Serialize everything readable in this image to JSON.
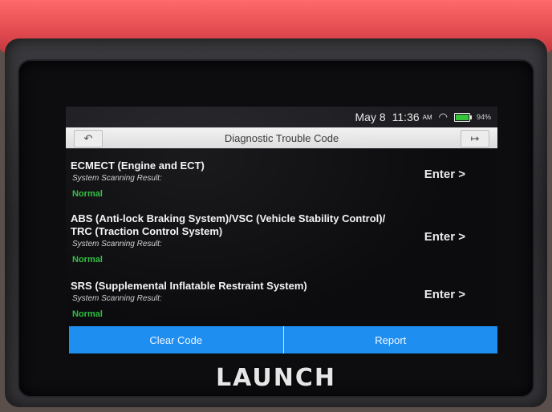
{
  "status_bar": {
    "date": "May 8",
    "time": "11:36",
    "ampm": "AM",
    "battery": "94%",
    "wifi_icon": "wifi-icon",
    "battery_icon": "battery-icon"
  },
  "header": {
    "title": "Diagnostic Trouble Code",
    "back_icon": "back-arrow-icon",
    "exit_icon": "exit-icon"
  },
  "systems": [
    {
      "name": "ECMECT (Engine and ECT)",
      "result_label": "System Scanning Result:",
      "result": "Normal",
      "enter_label": "Enter >"
    },
    {
      "name": "ABS (Anti-lock Braking System)/VSC (Vehicle Stability Control)/ TRC (Traction Control System)",
      "result_label": "System Scanning Result:",
      "result": "Normal",
      "enter_label": "Enter >"
    },
    {
      "name": "SRS (Supplemental Inflatable Restraint System)",
      "result_label": "System Scanning Result:",
      "result": "Normal",
      "enter_label": "Enter >"
    }
  ],
  "footer": {
    "clear_code": "Clear Code",
    "report": "Report"
  },
  "device": {
    "brand": "LAUNCH"
  },
  "colors": {
    "accent": "#1f8ef1",
    "normal": "#2fbf3f",
    "shell": "#e0484e"
  }
}
